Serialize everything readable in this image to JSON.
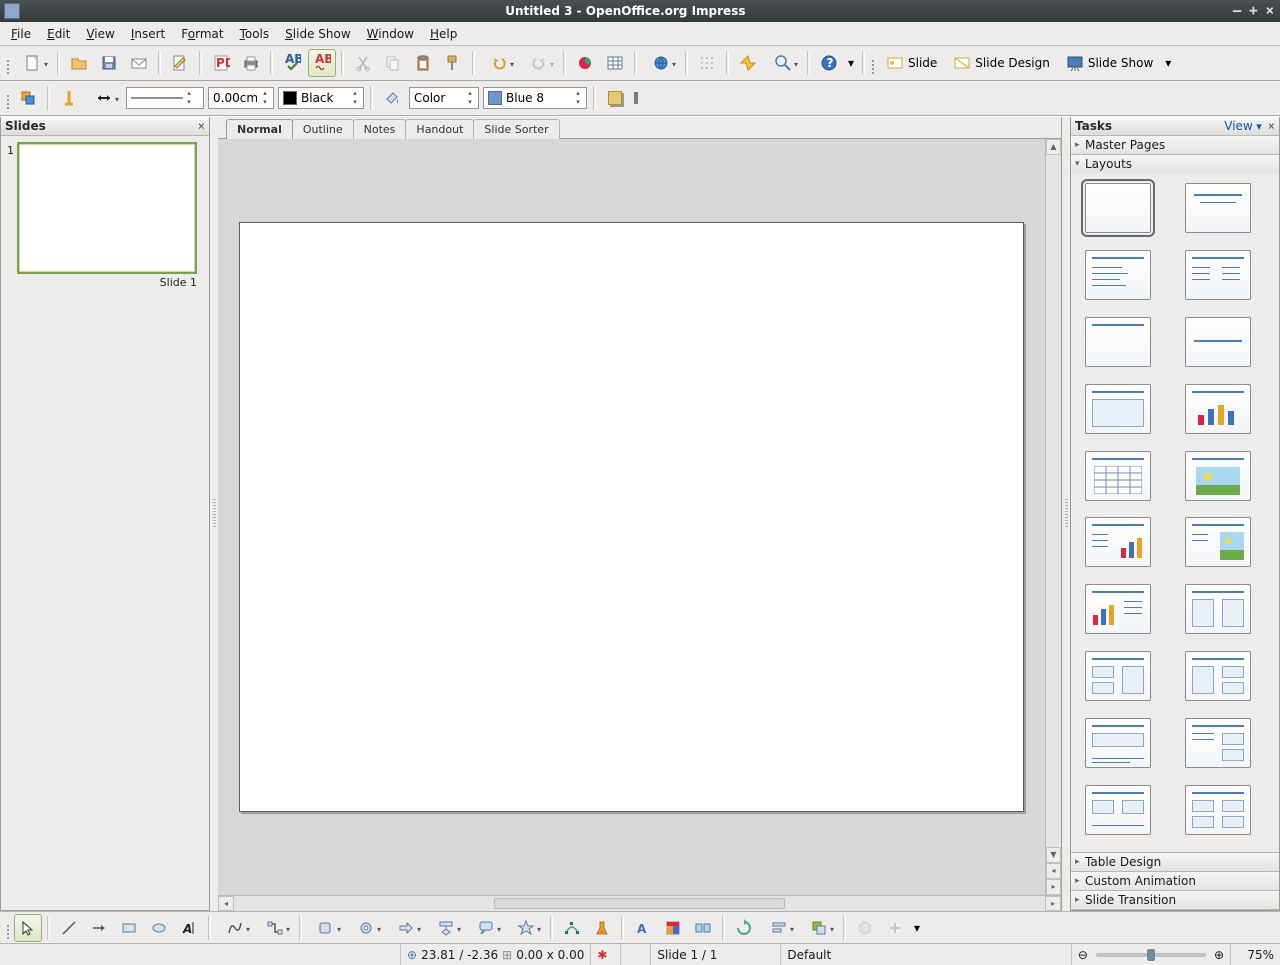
{
  "window": {
    "title": "Untitled 3 - OpenOffice.org Impress"
  },
  "menu": {
    "file": "File",
    "edit": "Edit",
    "view": "View",
    "insert": "Insert",
    "format": "Format",
    "tools": "Tools",
    "slideshow": "Slide Show",
    "window": "Window",
    "help": "Help"
  },
  "toolbar2": {
    "linewidth": "0.00cm",
    "linecolor_name": "Black",
    "fillmode": "Color",
    "fillcolor_name": "Blue 8"
  },
  "presentation_buttons": {
    "slide": "Slide",
    "slide_design": "Slide Design",
    "slide_show": "Slide Show"
  },
  "slides_panel": {
    "title": "Slides",
    "slide_label": "Slide 1",
    "slide_num": "1"
  },
  "viewtabs": {
    "normal": "Normal",
    "outline": "Outline",
    "notes": "Notes",
    "handout": "Handout",
    "sorter": "Slide Sorter"
  },
  "tasks": {
    "title": "Tasks",
    "view": "View",
    "master": "Master Pages",
    "layouts": "Layouts",
    "table": "Table Design",
    "anim": "Custom Animation",
    "trans": "Slide Transition"
  },
  "status": {
    "coords": "23.81 / -2.36",
    "size": "0.00 x 0.00",
    "slide": "Slide 1 / 1",
    "style": "Default",
    "zoom": "75%"
  }
}
